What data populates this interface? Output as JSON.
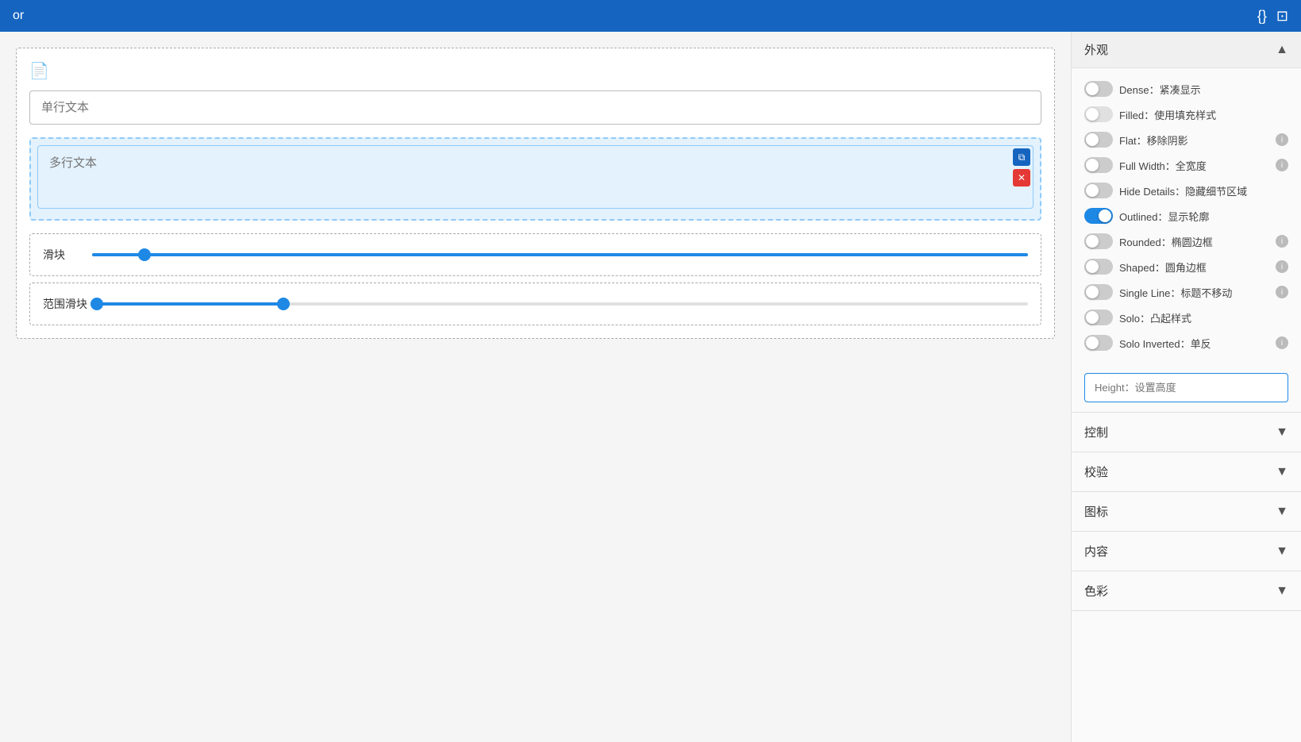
{
  "topbar": {
    "title": "or",
    "icon_code": "{}",
    "icon_expand": "⊡"
  },
  "left": {
    "single_line_placeholder": "单行文本",
    "multiline_placeholder": "多行文本",
    "slider_label": "滑块",
    "range_slider_label": "范围滑块",
    "slider_value": 5,
    "slider_min": 0,
    "slider_max": 100,
    "range_min_val": 10,
    "range_max_val": 30,
    "range_min": 0,
    "range_max": 100
  },
  "right": {
    "appearance_title": "外观",
    "toggles": [
      {
        "id": "dense",
        "label": "Dense：紧凑显示",
        "active": false,
        "disabled": false,
        "has_info": false
      },
      {
        "id": "filled",
        "label": "Filled：使用填充样式",
        "active": false,
        "disabled": true,
        "has_info": false
      },
      {
        "id": "flat",
        "label": "Flat：移除阴影",
        "active": false,
        "disabled": false,
        "has_info": true
      },
      {
        "id": "fullwidth",
        "label": "Full Width：全宽度",
        "active": false,
        "disabled": false,
        "has_info": true
      },
      {
        "id": "hidedetails",
        "label": "Hide Details：隐藏细节区域",
        "active": false,
        "disabled": false,
        "has_info": false
      },
      {
        "id": "outlined",
        "label": "Outlined：显示轮廓",
        "active": true,
        "disabled": false,
        "has_info": false
      },
      {
        "id": "rounded",
        "label": "Rounded：椭圆边框",
        "active": false,
        "disabled": false,
        "has_info": true
      },
      {
        "id": "shaped",
        "label": "Shaped：圆角边框",
        "active": false,
        "disabled": false,
        "has_info": true
      },
      {
        "id": "singleline",
        "label": "Single Line：标题不移动",
        "active": false,
        "disabled": false,
        "has_info": true
      },
      {
        "id": "solo",
        "label": "Solo：凸起样式",
        "active": false,
        "disabled": false,
        "has_info": false
      },
      {
        "id": "soloinverted",
        "label": "Solo Inverted：单反",
        "active": false,
        "disabled": false,
        "has_info": true
      }
    ],
    "height_placeholder": "Height：设置高度",
    "sections": [
      {
        "id": "control",
        "label": "控制"
      },
      {
        "id": "validate",
        "label": "校验"
      },
      {
        "id": "icon",
        "label": "图标"
      },
      {
        "id": "content",
        "label": "内容"
      },
      {
        "id": "color",
        "label": "色彩"
      }
    ]
  }
}
